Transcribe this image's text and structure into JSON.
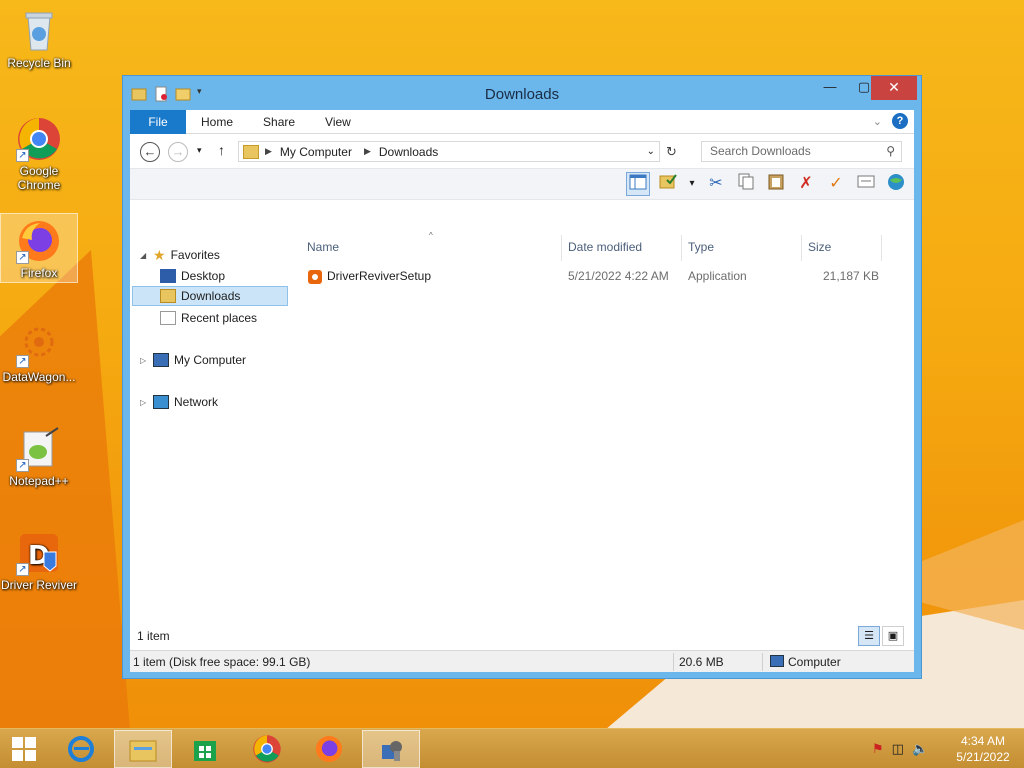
{
  "desktop": {
    "icons": [
      {
        "label": "Recycle Bin",
        "icon": "recycle-bin-icon"
      },
      {
        "label": "Google Chrome",
        "icon": "chrome-icon"
      },
      {
        "label": "Firefox",
        "icon": "firefox-icon"
      },
      {
        "label": "DataWagon...",
        "icon": "datawagon-icon"
      },
      {
        "label": "Notepad++",
        "icon": "notepadpp-icon"
      },
      {
        "label": "Driver Reviver",
        "icon": "driver-reviver-icon"
      }
    ]
  },
  "window": {
    "title": "Downloads",
    "ribbon": {
      "tabs": [
        "File",
        "Home",
        "Share",
        "View"
      ]
    },
    "address": {
      "crumbs": [
        "My Computer",
        "Downloads"
      ],
      "search_placeholder": "Search Downloads"
    },
    "nav": {
      "favorites": "Favorites",
      "items": [
        "Desktop",
        "Downloads",
        "Recent places"
      ],
      "my_computer": "My Computer",
      "network": "Network"
    },
    "columns": [
      "Name",
      "Date modified",
      "Type",
      "Size"
    ],
    "files": [
      {
        "name": "DriverReviverSetup",
        "date_modified": "5/21/2022 4:22 AM",
        "type": "Application",
        "size": "21,187 KB"
      }
    ],
    "item_count": "1 item",
    "status": {
      "left": "1 item (Disk free space: 99.1 GB)",
      "size": "20.6 MB",
      "location": "Computer"
    }
  },
  "taskbar": {
    "time": "4:34 AM",
    "date": "5/21/2022"
  },
  "colors": {
    "desktop": "#f5a910",
    "window_frame": "#6bb6ea",
    "file_tab": "#1979ca",
    "close_button": "#c94340"
  }
}
